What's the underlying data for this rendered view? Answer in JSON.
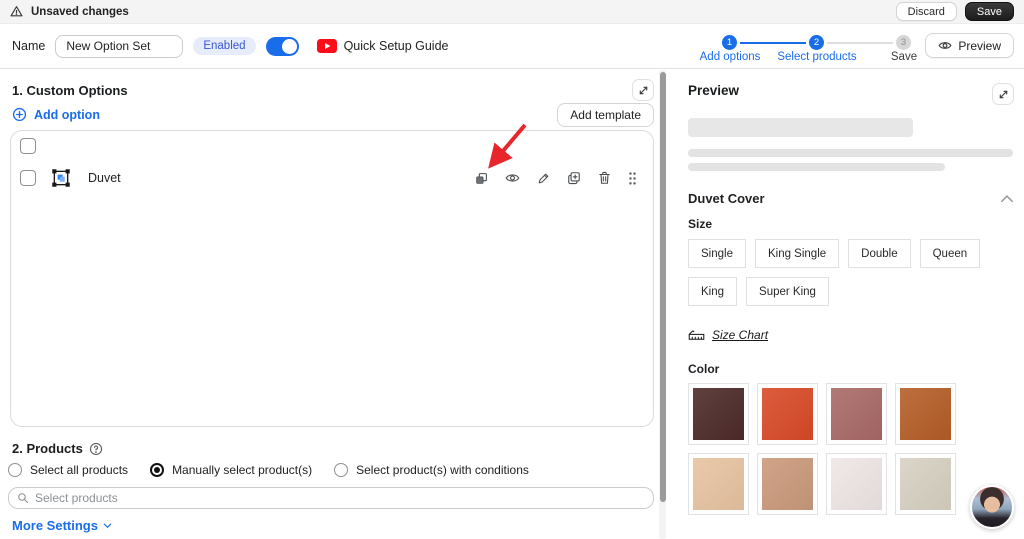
{
  "topbar": {
    "title": "Unsaved changes",
    "discard_label": "Discard",
    "save_label": "Save"
  },
  "toolbar": {
    "name_label": "Name",
    "name_value": "New Option Set",
    "enabled_badge": "Enabled",
    "guide_label": "Quick Setup Guide",
    "preview_label": "Preview",
    "stepper": [
      {
        "num": "1",
        "label": "Add options",
        "state": "active"
      },
      {
        "num": "2",
        "label": "Select products",
        "state": "active"
      },
      {
        "num": "3",
        "label": "Save",
        "state": "inactive"
      }
    ]
  },
  "options_panel": {
    "title": "1. Custom Options",
    "add_option_label": "Add option",
    "add_template_label": "Add template",
    "option_row": {
      "name": "Duvet"
    }
  },
  "products_panel": {
    "title": "2. Products",
    "radios": [
      {
        "label": "Select all products",
        "checked": false
      },
      {
        "label": "Manually select product(s)",
        "checked": true
      },
      {
        "label": "Select product(s) with conditions",
        "checked": false
      }
    ],
    "search_placeholder": "Select products",
    "more_settings_label": "More Settings"
  },
  "preview_panel": {
    "title": "Preview",
    "product_title": "Duvet Cover",
    "size_label": "Size",
    "sizes": [
      "Single",
      "King Single",
      "Double",
      "Queen",
      "King",
      "Super King"
    ],
    "size_chart_label": "Size Chart",
    "color_label": "Color",
    "swatch_colors": [
      "#4e2b29",
      "#d94a28",
      "#a96a67",
      "#b55e27",
      "#e8c4a2",
      "#cb9a7c",
      "#efe7e6",
      "#d8d1c3"
    ]
  },
  "icons": {
    "warning": "alert-triangle",
    "youtube": "youtube-play",
    "add": "plus-circle",
    "expand": "diagonal-expand-arrows",
    "row_actions": [
      "copy",
      "eye",
      "pencil",
      "duplicate-plus",
      "trash",
      "drag-handle"
    ],
    "help": "question-circle",
    "search": "magnifier",
    "size_chart": "ruler",
    "collapse": "chevron-up",
    "more": "chevron-down"
  },
  "colors": {
    "accent_blue": "#1a6de8",
    "badge_bg": "#e7ecfd",
    "badge_text": "#3a56d4",
    "save_button": "#1c1c1c",
    "annotation_arrow": "#e8252a",
    "youtube_red": "#fd0d1b",
    "step_inactive": "#d6d6d6"
  }
}
